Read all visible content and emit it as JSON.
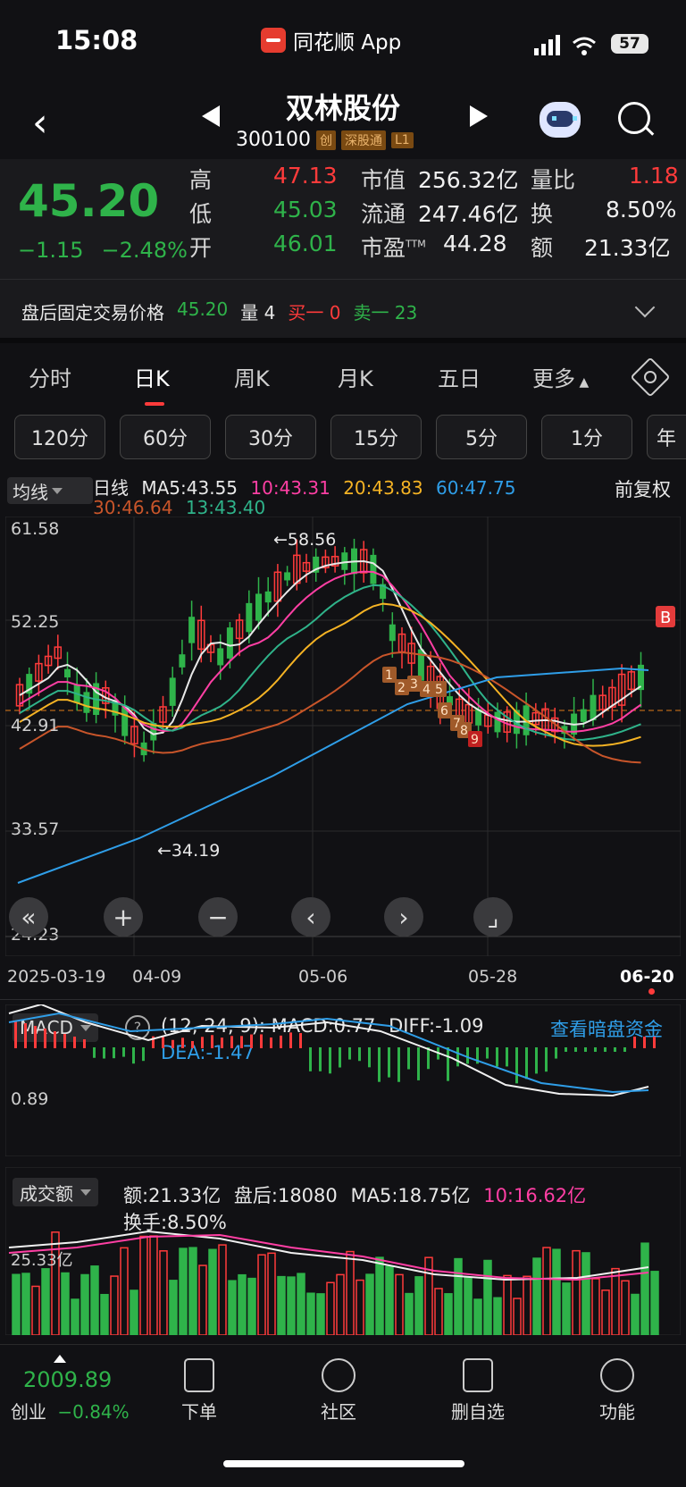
{
  "status": {
    "time": "15:08",
    "app": "同花顺 App",
    "battery": "57"
  },
  "header": {
    "title": "双林股份",
    "code": "300100",
    "tags": [
      "创",
      "深股通",
      "L1"
    ]
  },
  "quote": {
    "price": "45.20",
    "change": "−1.15",
    "pct": "−2.48%",
    "high_label": "高",
    "high": "47.13",
    "low_label": "低",
    "low": "45.03",
    "open_label": "开",
    "open": "46.01",
    "mcap_label": "市值",
    "mcap": "256.32亿",
    "float_label": "流通",
    "float": "247.46亿",
    "pe_label": "市盈",
    "pe_sup": "TTM",
    "pe": "44.28",
    "vr_label": "量比",
    "vr": "1.18",
    "turn_label": "换",
    "turn": "8.50%",
    "amt_label": "额",
    "amt": "21.33亿"
  },
  "afterhours": {
    "label": "盘后固定交易价格",
    "price": "45.20",
    "vol_label": "量",
    "vol": "4",
    "buy": "买一 0",
    "sell": "卖一 23"
  },
  "tabs": [
    "分时",
    "日K",
    "周K",
    "月K",
    "五日",
    "更多"
  ],
  "minute_buttons": [
    "120分",
    "60分",
    "30分",
    "15分",
    "5分",
    "1分",
    "年"
  ],
  "ma": {
    "selector": "均线",
    "line": "日线",
    "ma5": "MA5:43.55",
    "ma10": "10:43.31",
    "ma20": "20:43.83",
    "ma60": "60:47.75",
    "ma30": "30:46.64",
    "ma13": "13:43.40",
    "adjust": "前复权",
    "colors": {
      "ma5": "#e8e8e8",
      "ma10": "#ff3fa4",
      "ma20": "#f5b324",
      "ma60": "#2f9ee8",
      "ma30": "#c8552a",
      "ma13": "#2fb38a"
    }
  },
  "kchart": {
    "y_ticks": [
      "61.58",
      "52.25",
      "42.91",
      "33.57",
      "24.23"
    ],
    "x_ticks": [
      "2025-03-19",
      "04-09",
      "05-06",
      "05-28",
      "06-20"
    ],
    "high_marker": "←58.56",
    "low_marker": "←34.19",
    "signal": "B",
    "countdown": [
      "1",
      "2",
      "3",
      "4",
      "5",
      "6",
      "7",
      "8",
      "9"
    ]
  },
  "macd": {
    "selector": "MACD",
    "params": "(12, 24, 9):",
    "macd": "MACD:0.77",
    "diff": "DIFF:-1.09",
    "dea": "DEA:-1.47",
    "link": "查看暗盘资金",
    "ytick": "0.89"
  },
  "volume": {
    "selector": "成交额",
    "amt": "额:21.33亿",
    "after": "盘后:18080",
    "ma5": "MA5:18.75亿",
    "ma10": "10:16.62亿",
    "turn": "换手:8.50%",
    "ytick": "25.33亿"
  },
  "bottom": {
    "index_value": "2009.89",
    "index_name": "创业",
    "index_pct": "−0.84%",
    "items": [
      "下单",
      "社区",
      "删自选",
      "功能"
    ]
  }
}
